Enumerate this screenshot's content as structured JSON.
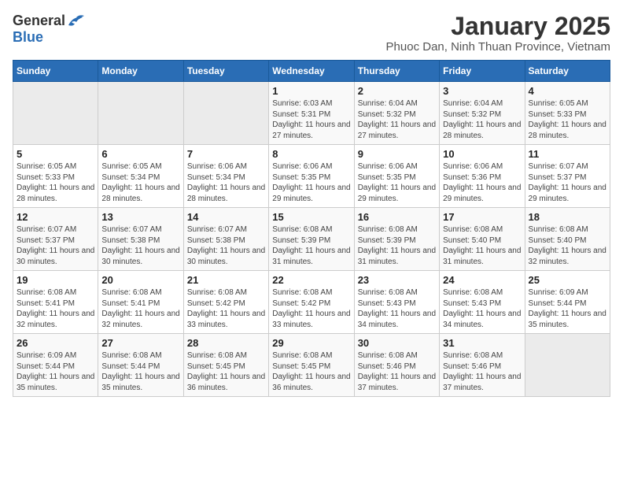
{
  "header": {
    "logo": {
      "general": "General",
      "blue": "Blue"
    },
    "title": "January 2025",
    "subtitle": "Phuoc Dan, Ninh Thuan Province, Vietnam"
  },
  "calendar": {
    "days_of_week": [
      "Sunday",
      "Monday",
      "Tuesday",
      "Wednesday",
      "Thursday",
      "Friday",
      "Saturday"
    ],
    "weeks": [
      [
        {
          "date": "",
          "sunrise": "",
          "sunset": "",
          "daylight": ""
        },
        {
          "date": "",
          "sunrise": "",
          "sunset": "",
          "daylight": ""
        },
        {
          "date": "",
          "sunrise": "",
          "sunset": "",
          "daylight": ""
        },
        {
          "date": "1",
          "sunrise": "Sunrise: 6:03 AM",
          "sunset": "Sunset: 5:31 PM",
          "daylight": "Daylight: 11 hours and 27 minutes."
        },
        {
          "date": "2",
          "sunrise": "Sunrise: 6:04 AM",
          "sunset": "Sunset: 5:32 PM",
          "daylight": "Daylight: 11 hours and 27 minutes."
        },
        {
          "date": "3",
          "sunrise": "Sunrise: 6:04 AM",
          "sunset": "Sunset: 5:32 PM",
          "daylight": "Daylight: 11 hours and 28 minutes."
        },
        {
          "date": "4",
          "sunrise": "Sunrise: 6:05 AM",
          "sunset": "Sunset: 5:33 PM",
          "daylight": "Daylight: 11 hours and 28 minutes."
        }
      ],
      [
        {
          "date": "5",
          "sunrise": "Sunrise: 6:05 AM",
          "sunset": "Sunset: 5:33 PM",
          "daylight": "Daylight: 11 hours and 28 minutes."
        },
        {
          "date": "6",
          "sunrise": "Sunrise: 6:05 AM",
          "sunset": "Sunset: 5:34 PM",
          "daylight": "Daylight: 11 hours and 28 minutes."
        },
        {
          "date": "7",
          "sunrise": "Sunrise: 6:06 AM",
          "sunset": "Sunset: 5:34 PM",
          "daylight": "Daylight: 11 hours and 28 minutes."
        },
        {
          "date": "8",
          "sunrise": "Sunrise: 6:06 AM",
          "sunset": "Sunset: 5:35 PM",
          "daylight": "Daylight: 11 hours and 29 minutes."
        },
        {
          "date": "9",
          "sunrise": "Sunrise: 6:06 AM",
          "sunset": "Sunset: 5:35 PM",
          "daylight": "Daylight: 11 hours and 29 minutes."
        },
        {
          "date": "10",
          "sunrise": "Sunrise: 6:06 AM",
          "sunset": "Sunset: 5:36 PM",
          "daylight": "Daylight: 11 hours and 29 minutes."
        },
        {
          "date": "11",
          "sunrise": "Sunrise: 6:07 AM",
          "sunset": "Sunset: 5:37 PM",
          "daylight": "Daylight: 11 hours and 29 minutes."
        }
      ],
      [
        {
          "date": "12",
          "sunrise": "Sunrise: 6:07 AM",
          "sunset": "Sunset: 5:37 PM",
          "daylight": "Daylight: 11 hours and 30 minutes."
        },
        {
          "date": "13",
          "sunrise": "Sunrise: 6:07 AM",
          "sunset": "Sunset: 5:38 PM",
          "daylight": "Daylight: 11 hours and 30 minutes."
        },
        {
          "date": "14",
          "sunrise": "Sunrise: 6:07 AM",
          "sunset": "Sunset: 5:38 PM",
          "daylight": "Daylight: 11 hours and 30 minutes."
        },
        {
          "date": "15",
          "sunrise": "Sunrise: 6:08 AM",
          "sunset": "Sunset: 5:39 PM",
          "daylight": "Daylight: 11 hours and 31 minutes."
        },
        {
          "date": "16",
          "sunrise": "Sunrise: 6:08 AM",
          "sunset": "Sunset: 5:39 PM",
          "daylight": "Daylight: 11 hours and 31 minutes."
        },
        {
          "date": "17",
          "sunrise": "Sunrise: 6:08 AM",
          "sunset": "Sunset: 5:40 PM",
          "daylight": "Daylight: 11 hours and 31 minutes."
        },
        {
          "date": "18",
          "sunrise": "Sunrise: 6:08 AM",
          "sunset": "Sunset: 5:40 PM",
          "daylight": "Daylight: 11 hours and 32 minutes."
        }
      ],
      [
        {
          "date": "19",
          "sunrise": "Sunrise: 6:08 AM",
          "sunset": "Sunset: 5:41 PM",
          "daylight": "Daylight: 11 hours and 32 minutes."
        },
        {
          "date": "20",
          "sunrise": "Sunrise: 6:08 AM",
          "sunset": "Sunset: 5:41 PM",
          "daylight": "Daylight: 11 hours and 32 minutes."
        },
        {
          "date": "21",
          "sunrise": "Sunrise: 6:08 AM",
          "sunset": "Sunset: 5:42 PM",
          "daylight": "Daylight: 11 hours and 33 minutes."
        },
        {
          "date": "22",
          "sunrise": "Sunrise: 6:08 AM",
          "sunset": "Sunset: 5:42 PM",
          "daylight": "Daylight: 11 hours and 33 minutes."
        },
        {
          "date": "23",
          "sunrise": "Sunrise: 6:08 AM",
          "sunset": "Sunset: 5:43 PM",
          "daylight": "Daylight: 11 hours and 34 minutes."
        },
        {
          "date": "24",
          "sunrise": "Sunrise: 6:08 AM",
          "sunset": "Sunset: 5:43 PM",
          "daylight": "Daylight: 11 hours and 34 minutes."
        },
        {
          "date": "25",
          "sunrise": "Sunrise: 6:09 AM",
          "sunset": "Sunset: 5:44 PM",
          "daylight": "Daylight: 11 hours and 35 minutes."
        }
      ],
      [
        {
          "date": "26",
          "sunrise": "Sunrise: 6:09 AM",
          "sunset": "Sunset: 5:44 PM",
          "daylight": "Daylight: 11 hours and 35 minutes."
        },
        {
          "date": "27",
          "sunrise": "Sunrise: 6:08 AM",
          "sunset": "Sunset: 5:44 PM",
          "daylight": "Daylight: 11 hours and 35 minutes."
        },
        {
          "date": "28",
          "sunrise": "Sunrise: 6:08 AM",
          "sunset": "Sunset: 5:45 PM",
          "daylight": "Daylight: 11 hours and 36 minutes."
        },
        {
          "date": "29",
          "sunrise": "Sunrise: 6:08 AM",
          "sunset": "Sunset: 5:45 PM",
          "daylight": "Daylight: 11 hours and 36 minutes."
        },
        {
          "date": "30",
          "sunrise": "Sunrise: 6:08 AM",
          "sunset": "Sunset: 5:46 PM",
          "daylight": "Daylight: 11 hours and 37 minutes."
        },
        {
          "date": "31",
          "sunrise": "Sunrise: 6:08 AM",
          "sunset": "Sunset: 5:46 PM",
          "daylight": "Daylight: 11 hours and 37 minutes."
        },
        {
          "date": "",
          "sunrise": "",
          "sunset": "",
          "daylight": ""
        }
      ]
    ]
  }
}
